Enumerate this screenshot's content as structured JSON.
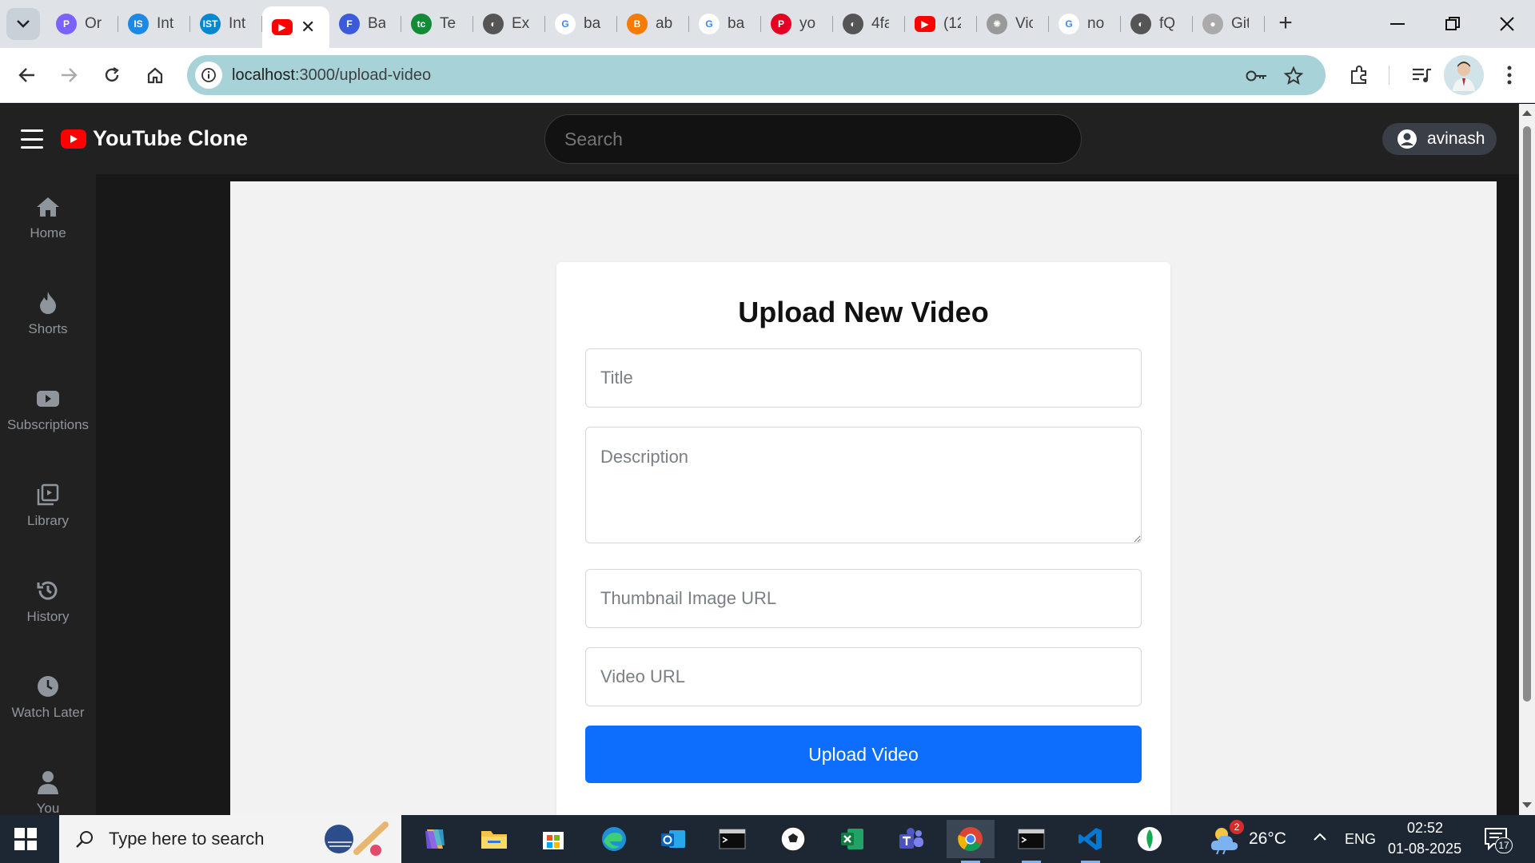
{
  "browser": {
    "tabs": [
      {
        "label": "Or",
        "icon": "copilot-icon",
        "color": "#7b61ff"
      },
      {
        "label": "Int",
        "icon": "is-icon",
        "color": "#1e88e5"
      },
      {
        "label": "Int",
        "icon": "ist-icon",
        "color": "#0288d1"
      },
      {
        "label": "",
        "icon": "youtube-icon",
        "color": "#ff0000",
        "active": true
      },
      {
        "label": "Ba",
        "icon": "form-icon",
        "color": "#3b5bdb"
      },
      {
        "label": "Te",
        "icon": "tc-icon",
        "color": "#138a36"
      },
      {
        "label": "Ex",
        "icon": "globe-icon",
        "color": "#555"
      },
      {
        "label": "ba",
        "icon": "google-icon",
        "color": "#4285f4"
      },
      {
        "label": "ab",
        "icon": "brave-icon",
        "color": "#f57c00"
      },
      {
        "label": "ba",
        "icon": "google-icon",
        "color": "#4285f4"
      },
      {
        "label": "yo",
        "icon": "pinterest-icon",
        "color": "#e60023"
      },
      {
        "label": "4fa",
        "icon": "globe-icon",
        "color": "#555"
      },
      {
        "label": "(12",
        "icon": "youtube-icon",
        "color": "#ff0000"
      },
      {
        "label": "Vic",
        "icon": "openai-icon",
        "color": "#999"
      },
      {
        "label": "no",
        "icon": "google-icon",
        "color": "#4285f4"
      },
      {
        "label": "fQ",
        "icon": "globe-icon",
        "color": "#555"
      },
      {
        "label": "Git",
        "icon": "github-icon",
        "color": "#aaa"
      }
    ],
    "url_host": "localhost",
    "url_path": ":3000/upload-video"
  },
  "app": {
    "brand": "YouTube Clone",
    "search_placeholder": "Search",
    "user": "avinash"
  },
  "sidebar": {
    "items": [
      {
        "label": "Home",
        "icon": "home-icon"
      },
      {
        "label": "Shorts",
        "icon": "fire-icon"
      },
      {
        "label": "Subscriptions",
        "icon": "subscriptions-icon"
      },
      {
        "label": "Library",
        "icon": "library-icon"
      },
      {
        "label": "History",
        "icon": "history-icon"
      },
      {
        "label": "Watch Later",
        "icon": "clock-icon"
      },
      {
        "label": "You",
        "icon": "user-icon"
      }
    ]
  },
  "form": {
    "title": "Upload New Video",
    "title_placeholder": "Title",
    "description_placeholder": "Description",
    "thumbnail_placeholder": "Thumbnail Image URL",
    "video_url_placeholder": "Video URL",
    "submit_label": "Upload Video"
  },
  "taskbar": {
    "search_placeholder": "Type here to search",
    "weather": "26°C",
    "weather_badge": "2",
    "language": "ENG",
    "time": "02:52",
    "date": "01-08-2025",
    "notifications": "17"
  },
  "colors": {
    "accent": "#0d6efd",
    "brand_red": "#ff0000",
    "header_bg": "#212121"
  }
}
